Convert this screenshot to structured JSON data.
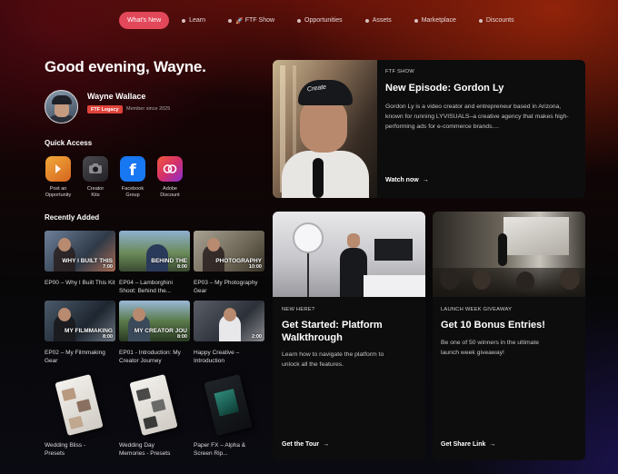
{
  "nav": {
    "items": [
      {
        "label": "What's New",
        "active": true
      },
      {
        "label": "Learn"
      },
      {
        "label": "FTF Show",
        "icon": "rocket-icon"
      },
      {
        "label": "Opportunities"
      },
      {
        "label": "Assets"
      },
      {
        "label": "Marketplace"
      },
      {
        "label": "Discounts"
      }
    ]
  },
  "greeting": "Good evening, Wayne.",
  "user": {
    "name": "Wayne Wallace",
    "badge": "FTF Legacy",
    "member_since": "Member since 2025"
  },
  "quick_access": {
    "title": "Quick Access",
    "items": [
      {
        "line1": "Post an",
        "line2": "Opportunity",
        "icon": "opportunity-icon",
        "color": "#e8932a"
      },
      {
        "line1": "Creator",
        "line2": "Kits",
        "icon": "camera-icon",
        "color": "#3a3a3c"
      },
      {
        "line1": "Facebook",
        "line2": "Group",
        "icon": "facebook-icon",
        "color": "#1877f2"
      },
      {
        "line1": "Adobe",
        "line2": "Discount",
        "icon": "adobe-cc-icon",
        "color": "#d4325e"
      }
    ]
  },
  "recently_added": {
    "title": "Recently Added",
    "videos": [
      {
        "title": "EP00 – Why I Built This Kit",
        "overlay": "WHY I BUILT THIS",
        "duration": "7:00"
      },
      {
        "title": "EP04 – Lamborghini Shoot: Behind the...",
        "overlay": "BEHIND THE",
        "duration": "8:00"
      },
      {
        "title": "EP03 – My Photography Gear",
        "overlay": "PHOTOGRAPHY",
        "duration": "10:00"
      },
      {
        "title": "EP02 – My Filmmaking Gear",
        "overlay": "MY FILMMAKING",
        "duration": "8:00"
      },
      {
        "title": "EP01 - Introduction: My Creator Journey",
        "overlay": "MY CREATOR JOU",
        "duration": "8:00"
      },
      {
        "title": "Happy Creative – Introduction",
        "overlay": "",
        "duration": "2:00"
      }
    ],
    "presets": [
      {
        "line1": "Wedding Bliss -",
        "line2": "Presets"
      },
      {
        "line1": "Wedding Day",
        "line2": "Memories - Presets"
      },
      {
        "line1": "Paper FX – Alpha &",
        "line2": "Screen Rip..."
      }
    ]
  },
  "featured": {
    "kicker": "FTF SHOW",
    "title": "New Episode: Gordon Ly",
    "description": "Gordon Ly is a video creator and entrepreneur based in Arizona, known for running LYVISUALS–a creative agency that makes high-performing ads for e-commerce brands....",
    "cta": "Watch now",
    "cap_text": "Create"
  },
  "cards": [
    {
      "kicker": "NEW HERE?",
      "title_line1": "Get Started: Platform",
      "title_line2": "Walkthrough",
      "desc_line1": "Learn how to navigate the platform to",
      "desc_line2": "unlock all the features.",
      "cta": "Get the Tour"
    },
    {
      "kicker": "LAUNCH WEEK GIVEAWAY",
      "title_line1": "Get 10 Bonus Entries!",
      "title_line2": "",
      "desc_line1": "Be one of 50 winners in the ultimate",
      "desc_line2": "launch week giveaway!",
      "cta": "Get Share Link"
    }
  ],
  "colors": {
    "accent": "#e2485a",
    "badge": "#e0433a"
  }
}
